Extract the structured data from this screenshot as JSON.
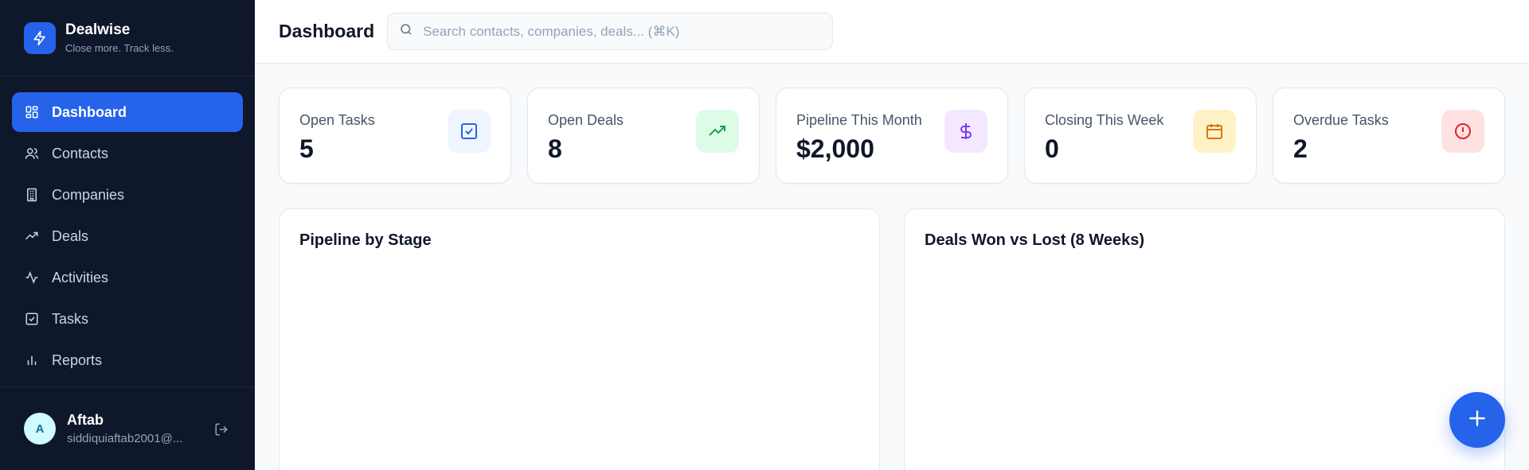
{
  "brand": {
    "name": "Dealwise",
    "tagline": "Close more. Track less."
  },
  "sidebar": {
    "items": [
      {
        "label": "Dashboard",
        "icon": "dashboard-icon"
      },
      {
        "label": "Contacts",
        "icon": "users-icon"
      },
      {
        "label": "Companies",
        "icon": "building-icon"
      },
      {
        "label": "Deals",
        "icon": "trending-up-icon"
      },
      {
        "label": "Activities",
        "icon": "activity-icon"
      },
      {
        "label": "Tasks",
        "icon": "check-square-icon"
      },
      {
        "label": "Reports",
        "icon": "bar-chart-icon"
      }
    ],
    "active": "Dashboard"
  },
  "user": {
    "initial": "A",
    "name": "Aftab",
    "email": "siddiquiaftab2001@..."
  },
  "header": {
    "title": "Dashboard",
    "search_placeholder": "Search contacts, companies, deals... (⌘K)"
  },
  "stats": [
    {
      "label": "Open Tasks",
      "value": "5",
      "icon": "check-square-icon",
      "color": "#2563eb",
      "bg": "#eff6ff"
    },
    {
      "label": "Open Deals",
      "value": "8",
      "icon": "trending-up-icon",
      "color": "#16a34a",
      "bg": "#dcfce7"
    },
    {
      "label": "Pipeline This Month",
      "value": "$2,000",
      "icon": "dollar-icon",
      "color": "#7c3aed",
      "bg": "#f3e8ff"
    },
    {
      "label": "Closing This Week",
      "value": "0",
      "icon": "calendar-icon",
      "color": "#d97706",
      "bg": "#fef3c7"
    },
    {
      "label": "Overdue Tasks",
      "value": "2",
      "icon": "alert-circle-icon",
      "color": "#dc2626",
      "bg": "#fee2e2"
    }
  ],
  "panels": {
    "left_title": "Pipeline by Stage",
    "right_title": "Deals Won vs Lost (8 Weeks)"
  },
  "colors": {
    "accent": "#2563eb",
    "sidebar_bg": "#0f172a"
  }
}
